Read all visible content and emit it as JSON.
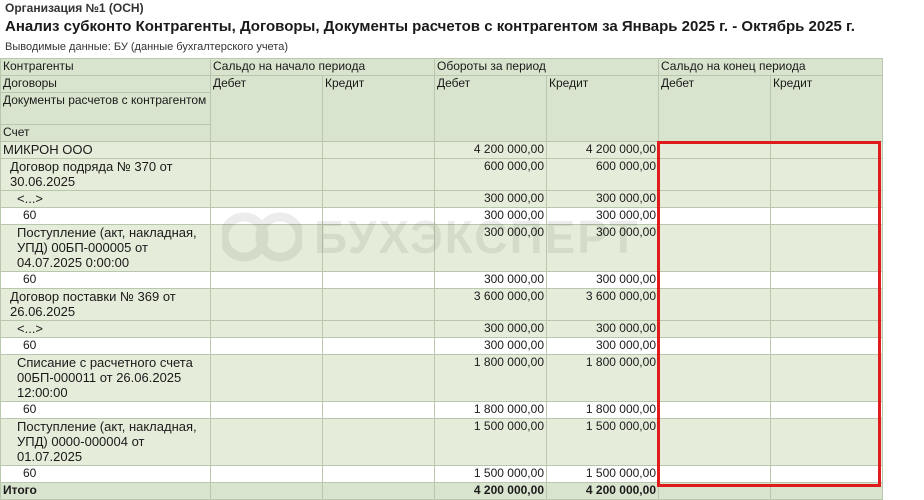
{
  "organization": "Организация №1 (ОСН)",
  "report_title": "Анализ субконто Контрагенты, Договоры, Документы расчетов с контрагентом за Январь 2025 г. - Октябрь 2025 г.",
  "output_data": "Выводимые данные: БУ (данные бухгалтерского учета)",
  "watermark": {
    "text": "БУХЭКСПЕРТ",
    "icon": "bukhexpert-logo-icon"
  },
  "headers": {
    "kontragenty": "Контрагенты",
    "dogovory": "Договоры",
    "dokumenty": "Документы расчетов с контрагентом",
    "schet": "Счет",
    "saldo_start": "Сальдо на начало периода",
    "oboroty": "Обороты за период",
    "saldo_end": "Сальдо на конец периода",
    "debet": "Дебет",
    "kredit": "Кредит"
  },
  "rows": [
    {
      "level": 0,
      "type": "grp",
      "name": "МИКРОН ООО",
      "od": "4 200 000,00",
      "ok": "4 200 000,00"
    },
    {
      "level": 1,
      "type": "grp",
      "name": "Договор подряда № 370 от 30.06.2025",
      "od": "600 000,00",
      "ok": "600 000,00"
    },
    {
      "level": 2,
      "type": "grp",
      "name": "<...>",
      "od": "300 000,00",
      "ok": "300 000,00"
    },
    {
      "level": 3,
      "type": "data",
      "name": "60",
      "od": "300 000,00",
      "ok": "300 000,00"
    },
    {
      "level": 2,
      "type": "grp",
      "name": "Поступление (акт, накладная, УПД) 00БП-000005 от 04.07.2025 0:00:00",
      "od": "300 000,00",
      "ok": "300 000,00"
    },
    {
      "level": 3,
      "type": "data",
      "name": "60",
      "od": "300 000,00",
      "ok": "300 000,00"
    },
    {
      "level": 1,
      "type": "grp",
      "name": "Договор поставки № 369 от 26.06.2025",
      "od": "3 600 000,00",
      "ok": "3 600 000,00"
    },
    {
      "level": 2,
      "type": "grp",
      "name": "<...>",
      "od": "300 000,00",
      "ok": "300 000,00"
    },
    {
      "level": 3,
      "type": "data",
      "name": "60",
      "od": "300 000,00",
      "ok": "300 000,00"
    },
    {
      "level": 2,
      "type": "grp",
      "name": "Списание с расчетного счета 00БП-000011 от 26.06.2025 12:00:00",
      "od": "1 800 000,00",
      "ok": "1 800 000,00"
    },
    {
      "level": 3,
      "type": "data",
      "name": "60",
      "od": "1 800 000,00",
      "ok": "1 800 000,00"
    },
    {
      "level": 2,
      "type": "grp",
      "name": "Поступление (акт, накладная, УПД) 0000-000004 от 01.07.2025",
      "od": "1 500 000,00",
      "ok": "1 500 000,00"
    },
    {
      "level": 3,
      "type": "data",
      "name": "60",
      "od": "1 500 000,00",
      "ok": "1 500 000,00"
    }
  ],
  "total": {
    "name": "Итого",
    "od": "4 200 000,00",
    "ok": "4 200 000,00"
  },
  "colors": {
    "header_bg": "#d8e4cd",
    "group_bg": "#e5edda",
    "border": "#b9c8ad",
    "highlight": "#e01b1b"
  }
}
